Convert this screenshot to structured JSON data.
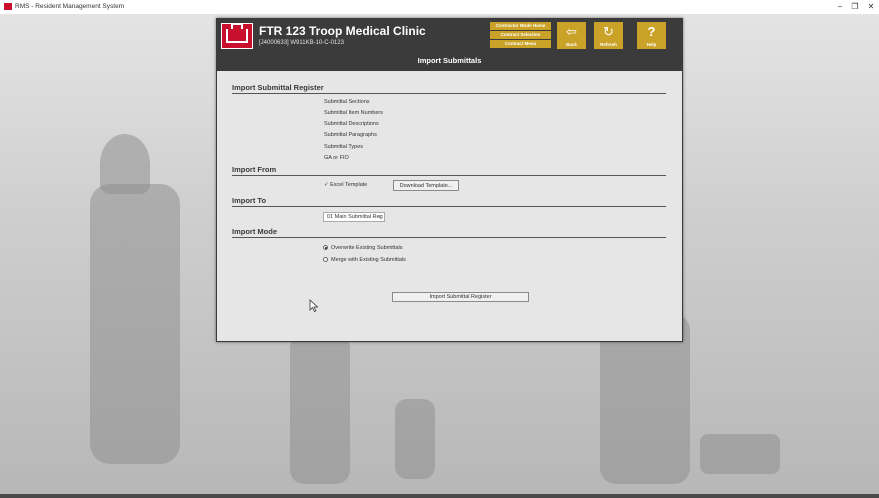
{
  "window": {
    "title": "RMS - Resident Management System",
    "minimize": "–",
    "restore": "❐",
    "close": "✕"
  },
  "header": {
    "project_title": "FTR 123 Troop Medical Clinic",
    "project_sub": "[J4000633] W911KB-10-C-0123",
    "nav": {
      "contractor_mode_home": "Contractor Mode Home",
      "contract_selection": "Contract Selection",
      "contract_menu": "Contract Menu"
    },
    "back": {
      "label": "Back",
      "icon": "back-arrow-icon",
      "glyph": "⇦"
    },
    "refresh": {
      "label": "Refresh",
      "icon": "refresh-icon",
      "glyph": "↻"
    },
    "help": {
      "label": "Help",
      "icon": "help-icon",
      "glyph": "?"
    }
  },
  "page_title": "Import Submittals",
  "sections": {
    "register": "Import Submittal Register",
    "from": "Import From",
    "to": "Import To",
    "mode": "Import Mode"
  },
  "register_items": [
    "Submittal Sections",
    "Submittal Item Numbers",
    "Submittal Descriptions",
    "Submittal Paragraphs",
    "Submittal Types",
    "GA or FIO"
  ],
  "import_from": {
    "check_mark": "✓",
    "excel_template": "Excel Template",
    "download_button": "Download Template..."
  },
  "import_to": {
    "selected": "01 Main Submittal Reg",
    "caret": "▾"
  },
  "import_mode": {
    "overwrite": "Overwrite Existing Submittals",
    "merge": "Merge with Existing Submittals",
    "selected": "overwrite"
  },
  "import_button": "Import Submittal Register",
  "colors": {
    "header_bg": "#3b3b3b",
    "accent_gold": "#c9a227",
    "logo_red": "#c8102e"
  }
}
